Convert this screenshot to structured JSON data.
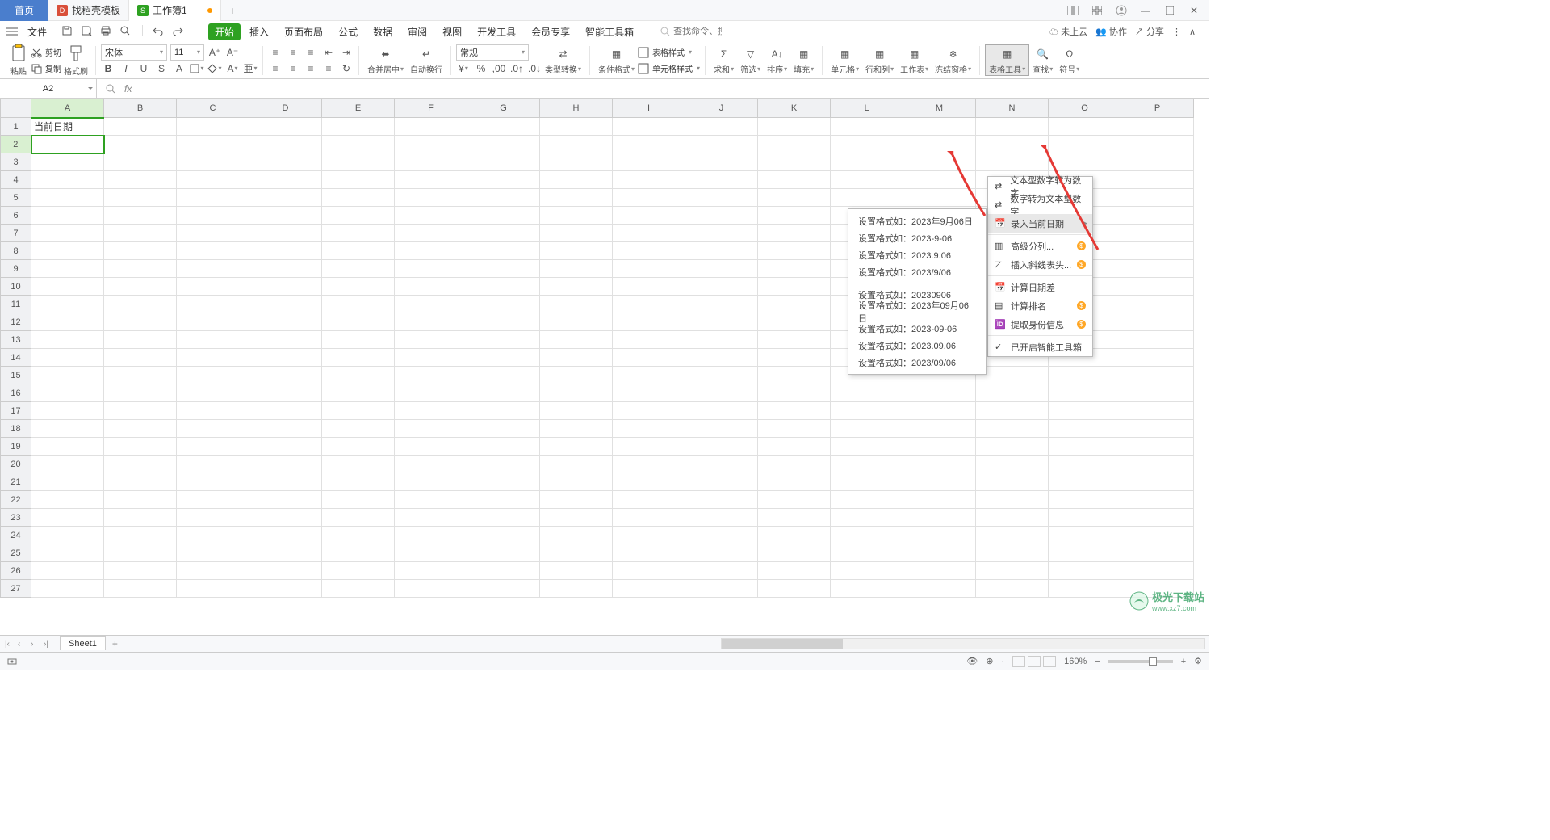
{
  "title_bar": {
    "home": "首页",
    "tab1": "找稻壳模板",
    "tab2": "工作簿1"
  },
  "menu": {
    "file": "文件",
    "tabs": [
      "开始",
      "插入",
      "页面布局",
      "公式",
      "数据",
      "审阅",
      "视图",
      "开发工具",
      "会员专享",
      "智能工具箱"
    ],
    "search_placeholder": "查找命令、搜索模板",
    "cloud": "未上云",
    "collab": "协作",
    "share": "分享"
  },
  "ribbon": {
    "paste": "粘贴",
    "cut": "剪切",
    "copy": "复制",
    "format_painter": "格式刷",
    "font_name": "宋体",
    "font_size": "11",
    "merge_center": "合并居中",
    "wrap": "自动换行",
    "number_format": "常规",
    "type_convert": "类型转换",
    "cond_format": "条件格式",
    "table_style": "表格样式",
    "cell_style": "单元格样式",
    "sum": "求和",
    "filter": "筛选",
    "sort": "排序",
    "fill": "填充",
    "cells": "单元格",
    "rowcol": "行和列",
    "worksheet": "工作表",
    "freeze": "冻结窗格",
    "table_tools": "表格工具",
    "find": "查找",
    "symbol": "符号"
  },
  "formula_bar": {
    "cell_ref": "A2"
  },
  "columns": [
    "A",
    "B",
    "C",
    "D",
    "E",
    "F",
    "G",
    "H",
    "I",
    "J",
    "K",
    "L",
    "M",
    "N",
    "O",
    "P"
  ],
  "rows_count": 27,
  "cells": {
    "A1": "当前日期"
  },
  "active_cell": "A2",
  "dropdown_main": {
    "items": [
      {
        "label": "文本型数字转为数字",
        "icon": "convert"
      },
      {
        "label": "数字转为文本型数字",
        "icon": "convert"
      },
      {
        "label": "录入当前日期",
        "icon": "calendar",
        "submenu": true,
        "highlighted": true
      },
      {
        "label": "高级分列...",
        "icon": "split",
        "pay": true
      },
      {
        "label": "插入斜线表头...",
        "icon": "diag",
        "pay": true
      },
      {
        "label": "计算日期差",
        "icon": "calendar"
      },
      {
        "label": "计算排名",
        "icon": "rank",
        "pay": true
      },
      {
        "label": "提取身份信息",
        "icon": "id",
        "pay": true
      },
      {
        "label": "已开启智能工具箱",
        "icon": "check"
      }
    ]
  },
  "dropdown_sub": {
    "items": [
      "设置格式如：2023年9月06日",
      "设置格式如：2023-9-06",
      "设置格式如：2023.9.06",
      "设置格式如：2023/9/06",
      "设置格式如：20230906",
      "设置格式如：2023年09月06日",
      "设置格式如：2023-09-06",
      "设置格式如：2023.09.06",
      "设置格式如：2023/09/06"
    ]
  },
  "sheet_tabs": {
    "sheet1": "Sheet1"
  },
  "status": {
    "zoom": "160%"
  },
  "watermark": {
    "name": "极光下载站",
    "url": "www.xz7.com"
  }
}
